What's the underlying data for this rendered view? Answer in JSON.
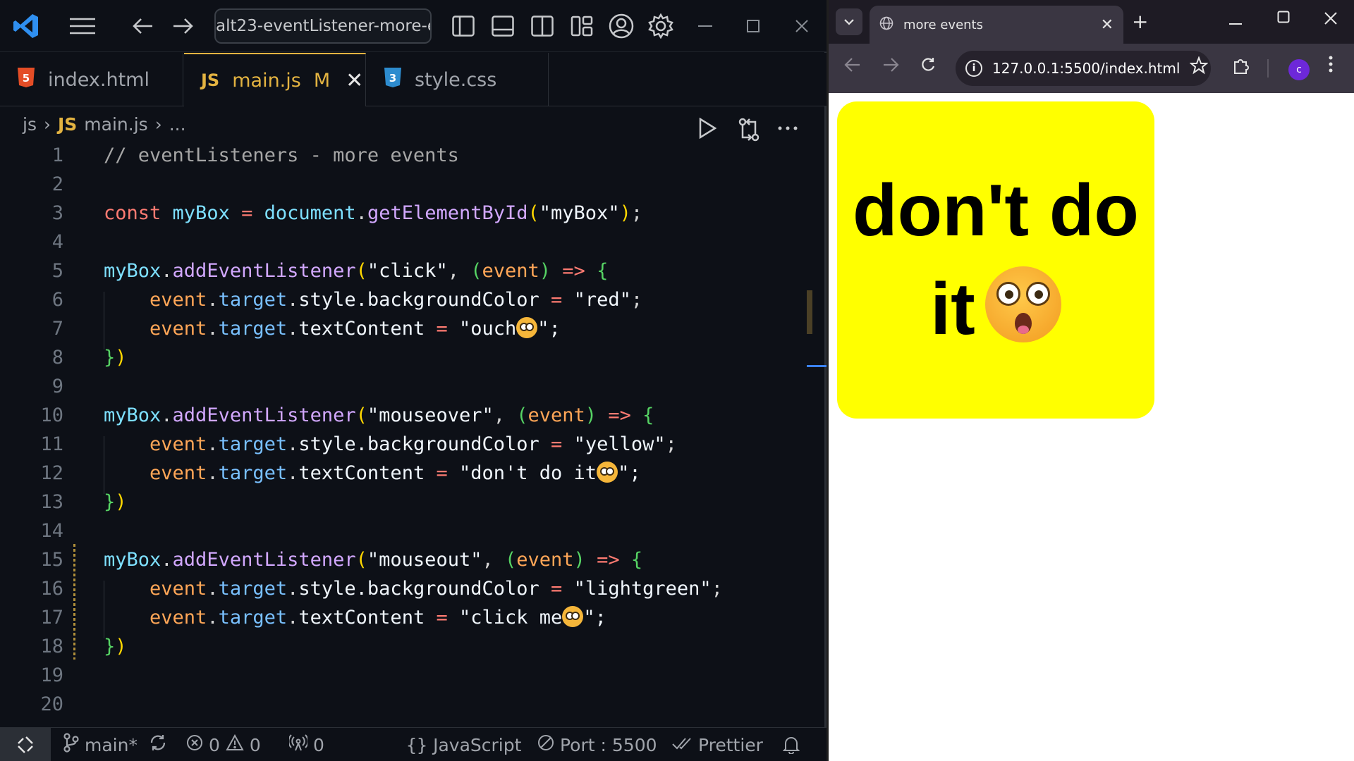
{
  "vscode": {
    "command_center": "alt23-eventListener-more-e",
    "tabs": [
      {
        "icon": "5",
        "label": "index.html"
      },
      {
        "icon": "JS",
        "label": "main.js",
        "modified": "M"
      },
      {
        "icon": "3",
        "label": "style.css"
      }
    ],
    "breadcrumb": {
      "folder": "js",
      "file_badge": "JS",
      "file": "main.js",
      "more": "..."
    },
    "line_numbers": [
      "1",
      "2",
      "3",
      "4",
      "5",
      "6",
      "7",
      "8",
      "9",
      "10",
      "11",
      "12",
      "13",
      "14",
      "15",
      "16",
      "17",
      "18",
      "19",
      "20"
    ],
    "status": {
      "branch": "main*",
      "errors": "0",
      "warnings": "0",
      "ports": "0",
      "language": "JavaScript",
      "port": "Port : 5500",
      "formatter": "Prettier"
    }
  },
  "code": {
    "l1": "// eventListeners - more events",
    "const": "const",
    "myBox": "myBox",
    "document": "document",
    "getElementById": "getElementById",
    "myBox_str": "\"myBox\"",
    "addEventListener": "addEventListener",
    "click_str": "\"click\"",
    "mouseover_str": "\"mouseover\"",
    "mouseout_str": "\"mouseout\"",
    "event": "event",
    "target": "target",
    "style_bg": "style.backgroundColor",
    "textContent": "textContent",
    "red_str": "\"red\"",
    "yellow_str": "\"yellow\"",
    "lightgreen_str": "\"lightgreen\"",
    "ouch_str": "\"ouch",
    "dont_str": "\"don't do it",
    "clickme_str": "\"click me",
    "quote_end": "\";"
  },
  "browser": {
    "tab_title": "more events",
    "url": "127.0.0.1:5500/index.html",
    "profile_initial": "c",
    "box": {
      "text": "don't do it",
      "background": "#ffff00"
    }
  },
  "colors": {
    "accent": "#e3b341",
    "box_yellow": "#ffff00"
  }
}
